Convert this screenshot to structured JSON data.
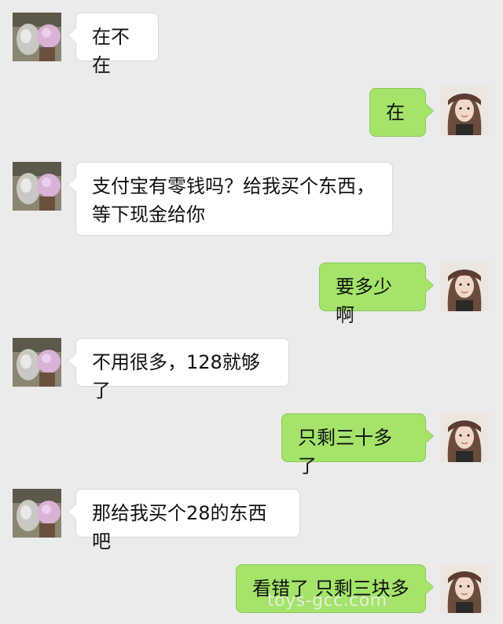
{
  "messages": [
    {
      "side": "left",
      "avatar": "cat-avatar",
      "text": "在不在"
    },
    {
      "side": "right",
      "avatar": "girl-avatar",
      "text": "在"
    },
    {
      "side": "left",
      "avatar": "cat-avatar",
      "text": "支付宝有零钱吗？给我买个东西，\n等下现金给你"
    },
    {
      "side": "right",
      "avatar": "girl-avatar",
      "text": "要多少啊"
    },
    {
      "side": "left",
      "avatar": "cat-avatar",
      "text": "不用很多，128就够了"
    },
    {
      "side": "right",
      "avatar": "girl-avatar",
      "text": "只剩三十多了"
    },
    {
      "side": "left",
      "avatar": "cat-avatar",
      "text": "那给我买个28的东西吧"
    },
    {
      "side": "right",
      "avatar": "girl-avatar",
      "text": "看错了 只剩三块多"
    }
  ],
  "watermark": "toys-gcc.com"
}
